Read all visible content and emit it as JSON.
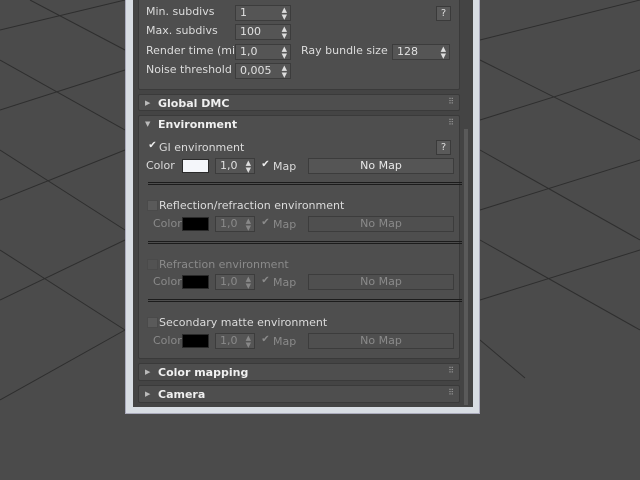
{
  "top": {
    "min_subdivs_label": "Min. subdivs",
    "min_subdivs": "1",
    "max_subdivs_label": "Max. subdivs",
    "max_subdivs": "100",
    "render_time_label": "Render time (min)",
    "render_time": "1,0",
    "ray_bundle_label": "Ray bundle size",
    "ray_bundle": "128",
    "noise_label": "Noise threshold",
    "noise": "0,005",
    "help": "?"
  },
  "rollouts": {
    "global_dmc": "Global DMC",
    "environment": "Environment",
    "color_mapping": "Color mapping",
    "camera": "Camera"
  },
  "env": {
    "gi": {
      "label": "GI environment",
      "checked": true,
      "color_label": "Color",
      "color": "#f4f6fa",
      "mult": "1,0",
      "map_label": "Map",
      "map_btn": "No Map"
    },
    "refl": {
      "label": "Reflection/refraction environment",
      "checked": false,
      "color_label": "Color",
      "color": "#000000",
      "mult": "1,0",
      "map_label": "Map",
      "map_btn": "No Map"
    },
    "refr": {
      "label": "Refraction environment",
      "checked": false,
      "color_label": "Color",
      "color": "#000000",
      "mult": "1,0",
      "map_label": "Map",
      "map_btn": "No Map"
    },
    "matte": {
      "label": "Secondary matte environment",
      "checked": false,
      "color_label": "Color",
      "color": "#000000",
      "mult": "1,0",
      "map_label": "Map",
      "map_btn": "No Map"
    },
    "help": "?"
  }
}
